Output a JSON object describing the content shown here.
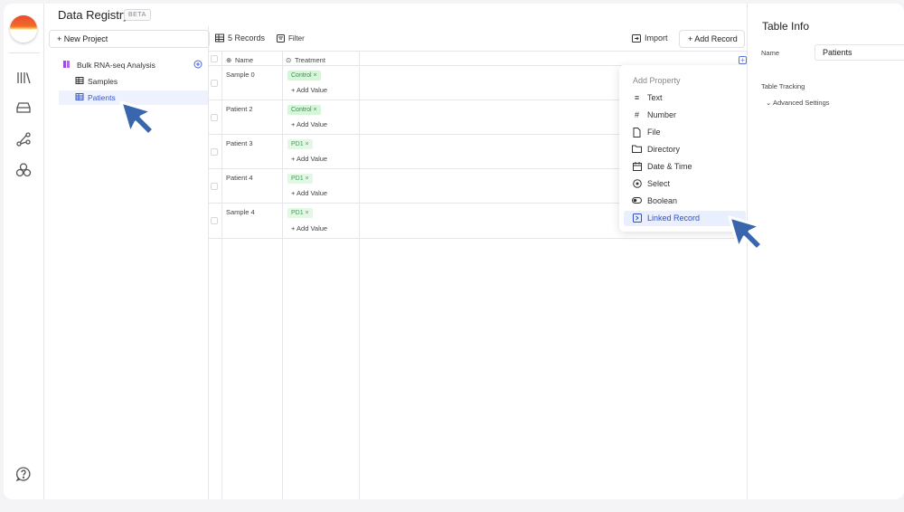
{
  "app": {
    "title": "Data Registry",
    "badge": "BETA"
  },
  "rail": {
    "icons": [
      "library-icon",
      "storage-icon",
      "workflow-icon",
      "packages-icon",
      "help-icon"
    ]
  },
  "sidebar": {
    "new_project_label": "+ New Project",
    "project": {
      "label": "Bulk RNA-seq Analysis",
      "icon": "project-icon",
      "color": "#9d4dd6"
    },
    "tables": [
      {
        "label": "Samples",
        "selected": false
      },
      {
        "label": "Patients",
        "selected": true
      }
    ]
  },
  "toolbar": {
    "records_label": "5 Records",
    "filter_label": "Filter",
    "import_label": "Import",
    "add_record_label": "+ Add Record"
  },
  "table": {
    "columns": [
      {
        "label": "Name",
        "icon": "name-icon"
      },
      {
        "label": "Treatment",
        "icon": "select-icon"
      }
    ],
    "rows": [
      {
        "name": "Sample 0",
        "tag": "Control ×",
        "tag_kind": "control",
        "add_value": "+ Add Value"
      },
      {
        "name": "Patient 2",
        "tag": "Control ×",
        "tag_kind": "control",
        "add_value": "+ Add Value"
      },
      {
        "name": "Patient 3",
        "tag": "PD1 ×",
        "tag_kind": "pd1",
        "add_value": "+ Add Value"
      },
      {
        "name": "Patient 4",
        "tag": "PD1 ×",
        "tag_kind": "pd1",
        "add_value": "+ Add Value"
      },
      {
        "name": "Sample 4",
        "tag": "PD1 ×",
        "tag_kind": "pd1",
        "add_value": "+ Add Value"
      }
    ]
  },
  "add_property_menu": {
    "title": "Add Property",
    "items": [
      {
        "label": "Text",
        "icon": "text-icon",
        "active": false
      },
      {
        "label": "Number",
        "icon": "number-icon",
        "active": false
      },
      {
        "label": "File",
        "icon": "file-icon",
        "active": false
      },
      {
        "label": "Directory",
        "icon": "folder-icon",
        "active": false
      },
      {
        "label": "Date & Time",
        "icon": "calendar-icon",
        "active": false
      },
      {
        "label": "Select",
        "icon": "select-icon",
        "active": false
      },
      {
        "label": "Boolean",
        "icon": "toggle-icon",
        "active": false
      },
      {
        "label": "Linked Record",
        "icon": "link-record-icon",
        "active": true
      }
    ]
  },
  "right_panel": {
    "title": "Table Info",
    "name_label": "Name",
    "name_value": "Patients",
    "tracking_label": "Table Tracking",
    "advanced_label": "Advanced Settings"
  },
  "colors": {
    "accent": "#3f55c7",
    "tag_green": "#2c9a45",
    "cursor": "#2f5ea8"
  }
}
